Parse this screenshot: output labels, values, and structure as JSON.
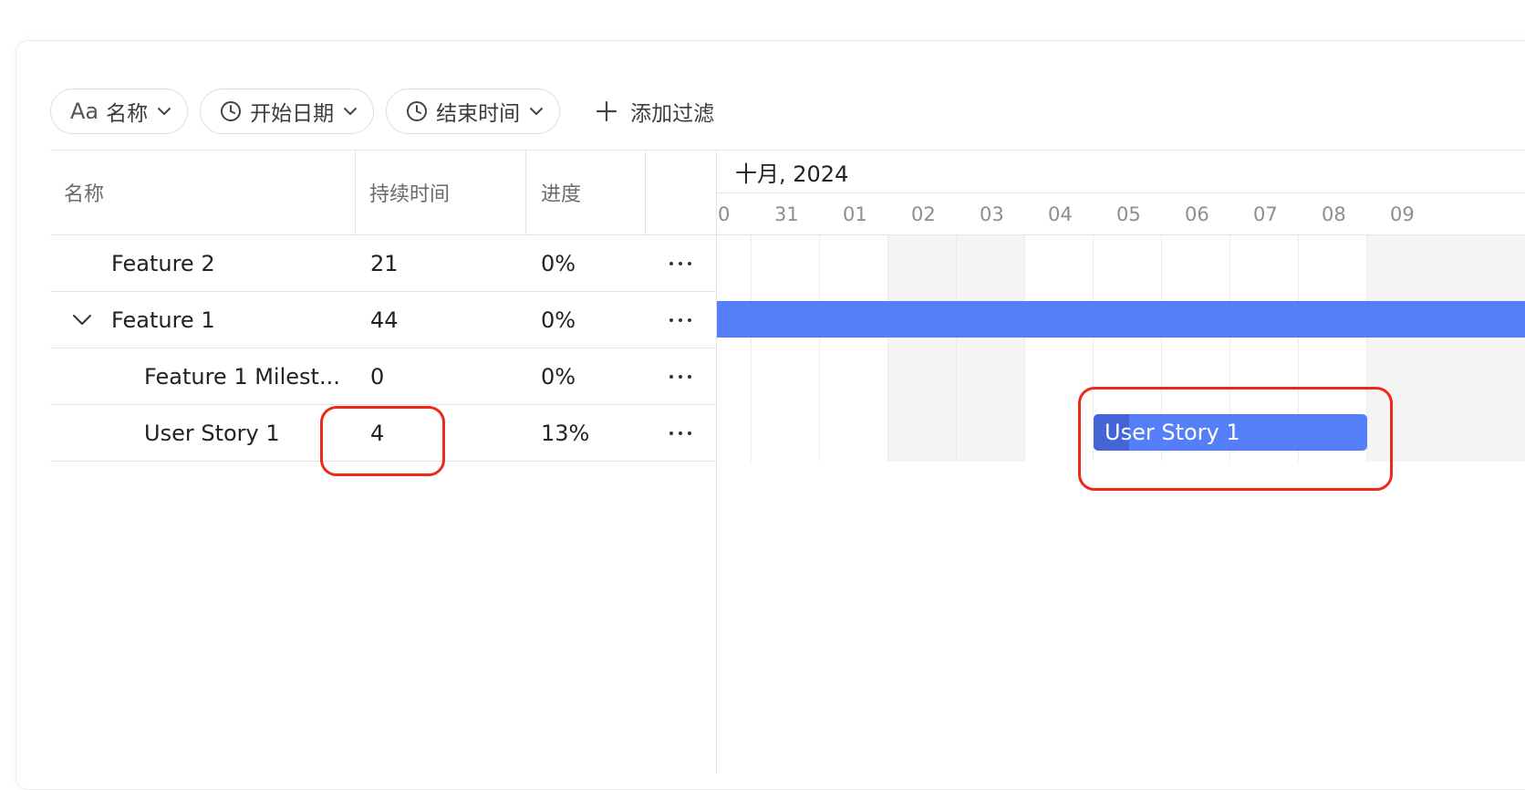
{
  "filters": {
    "name": {
      "prefix": "Aa",
      "label": "名称"
    },
    "start_date": {
      "label": "开始日期"
    },
    "end_date": {
      "label": "结束时间"
    },
    "add_filter": {
      "label": "添加过滤"
    }
  },
  "table": {
    "headers": {
      "name": "名称",
      "duration": "持续时间",
      "progress": "进度"
    },
    "rows": [
      {
        "name": "Feature 2",
        "duration": "21",
        "progress": "0%",
        "level": 1,
        "expandable": false
      },
      {
        "name": "Feature 1",
        "duration": "44",
        "progress": "0%",
        "level": 1,
        "expandable": true,
        "expanded": true
      },
      {
        "name": "Feature 1 Milest...",
        "duration": "0",
        "progress": "0%",
        "level": 2,
        "expandable": false
      },
      {
        "name": "User Story 1",
        "duration": "4",
        "progress": "13%",
        "level": 2,
        "expandable": false
      }
    ]
  },
  "gantt": {
    "month_label": "十月, 2024",
    "days": [
      "0",
      "31",
      "01",
      "02",
      "03",
      "04",
      "05",
      "06",
      "07",
      "08",
      "09"
    ],
    "weekend_days": [
      "02",
      "03",
      "09"
    ],
    "bars": {
      "feature_1": {
        "label": "",
        "color": "#547ff8"
      },
      "user_story_1": {
        "label": "User Story 1",
        "color": "#547ff8",
        "progress_fraction": 0.13,
        "start_day": "05",
        "duration_days": 4
      }
    }
  },
  "colors": {
    "bar": "#547ff8",
    "bar_progress": "#4565d6",
    "highlight": "#ee2a17",
    "weekend": "#f4f4f4"
  },
  "icons": {
    "clock": "clock-icon",
    "chevron": "chevron-down-icon",
    "plus": "plus-icon",
    "more": "more-horizontal-icon"
  }
}
